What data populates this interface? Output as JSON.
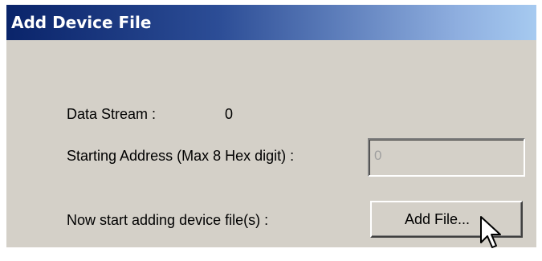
{
  "dialog": {
    "title": "Add Device File",
    "data_stream_label": "Data Stream :",
    "data_stream_value": "0",
    "starting_address_label": "Starting Address (Max 8 Hex digit) :",
    "starting_address_value": "0",
    "add_files_label": "Now start adding device file(s) :",
    "add_file_button": "Add File..."
  },
  "colors": {
    "title_bar_start": "#0a246a",
    "title_bar_end": "#a6caf0",
    "dialog_background": "#d4d0c8"
  },
  "icons": [
    "mouse-pointer-icon"
  ]
}
